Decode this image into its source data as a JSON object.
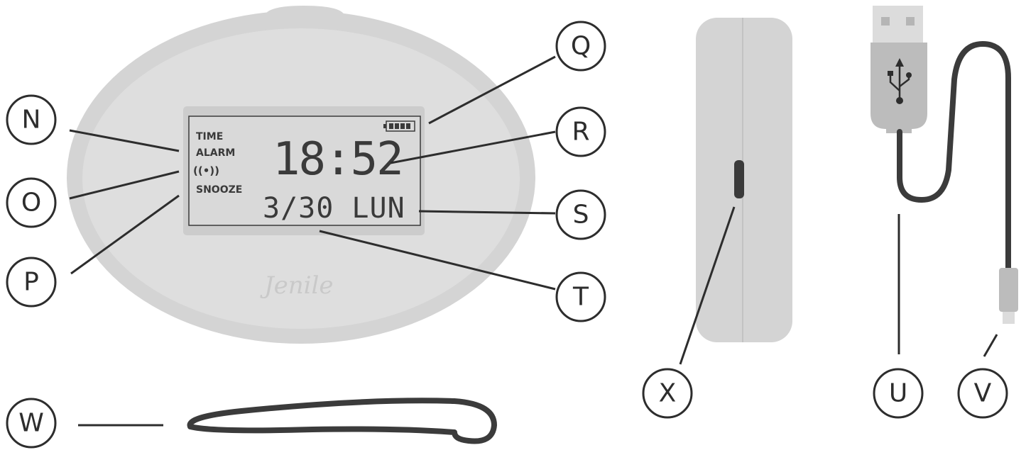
{
  "colors": {
    "body_outer": "#d4d4d4",
    "body_inner": "#dedede",
    "display_frame": "#cccccc",
    "display_face": "#d9d9d9",
    "segments": "#3a3a3a",
    "outline": "#2d2d2d",
    "cable": "#3b3b3b",
    "plug": "#bcbcbc"
  },
  "display": {
    "time_label": "TIME",
    "alarm_label": "ALARM",
    "alarm_icon": "((•))",
    "snooze_label": "SNOOZE",
    "time": "18:52",
    "date": "3/30 LUN",
    "battery_icon": "battery-icon"
  },
  "brand": "Jenile",
  "callouts": [
    "N",
    "O",
    "P",
    "Q",
    "R",
    "S",
    "T",
    "U",
    "V",
    "W",
    "X"
  ]
}
